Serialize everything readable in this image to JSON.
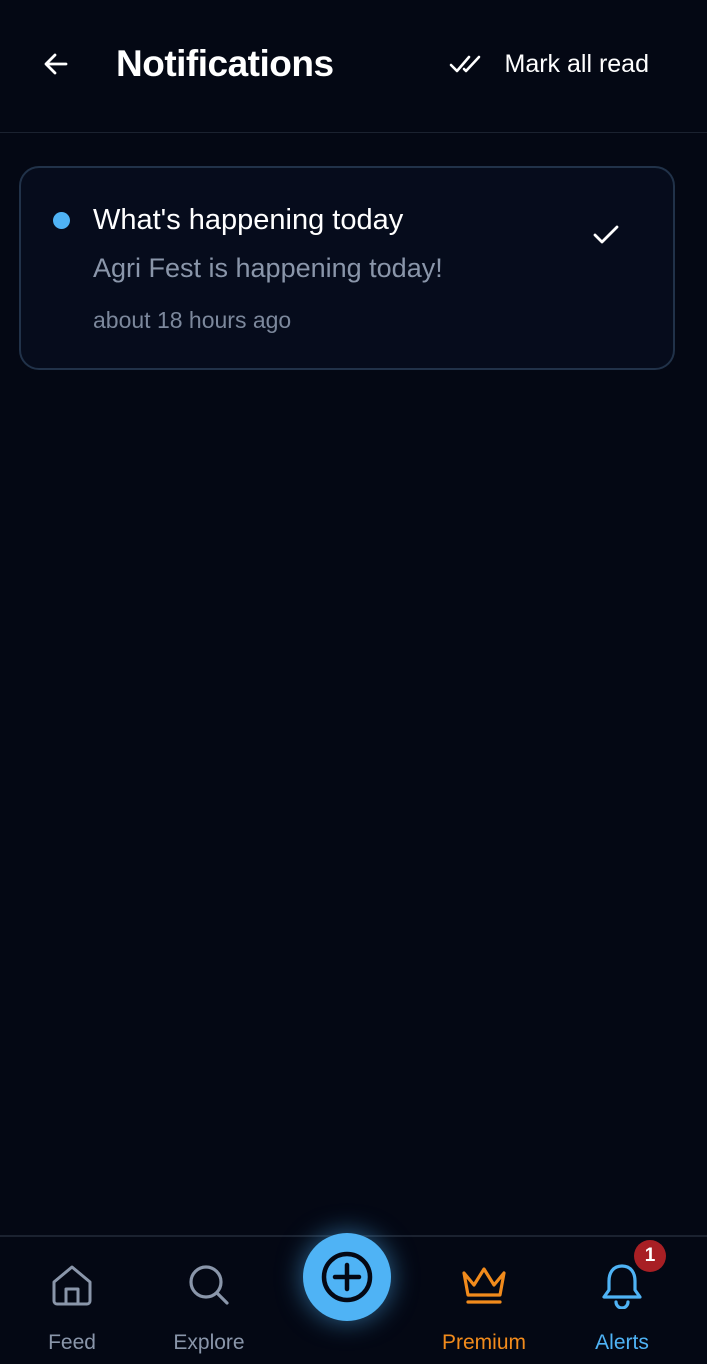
{
  "header": {
    "title": "Notifications",
    "mark_all_label": "Mark all read",
    "back_icon": "arrow-left-icon",
    "mark_all_icon": "double-check-icon"
  },
  "notifications": [
    {
      "title": "What's happening today",
      "body": "Agri Fest is happening today!",
      "time": "about 18 hours ago",
      "unread": true
    }
  ],
  "bottom_nav": {
    "items": [
      {
        "label": "Feed",
        "icon": "home-icon"
      },
      {
        "label": "Explore",
        "icon": "search-icon"
      },
      {
        "label": "Premium",
        "icon": "crown-icon"
      },
      {
        "label": "Alerts",
        "icon": "bell-icon"
      }
    ],
    "fab_icon": "plus-circle-icon",
    "alerts_badge": "1"
  },
  "colors": {
    "background": "#040814",
    "accent": "#4fb3f5",
    "premium": "#f28b1c",
    "badge": "#a81f24",
    "muted_text": "#8a96aa"
  }
}
